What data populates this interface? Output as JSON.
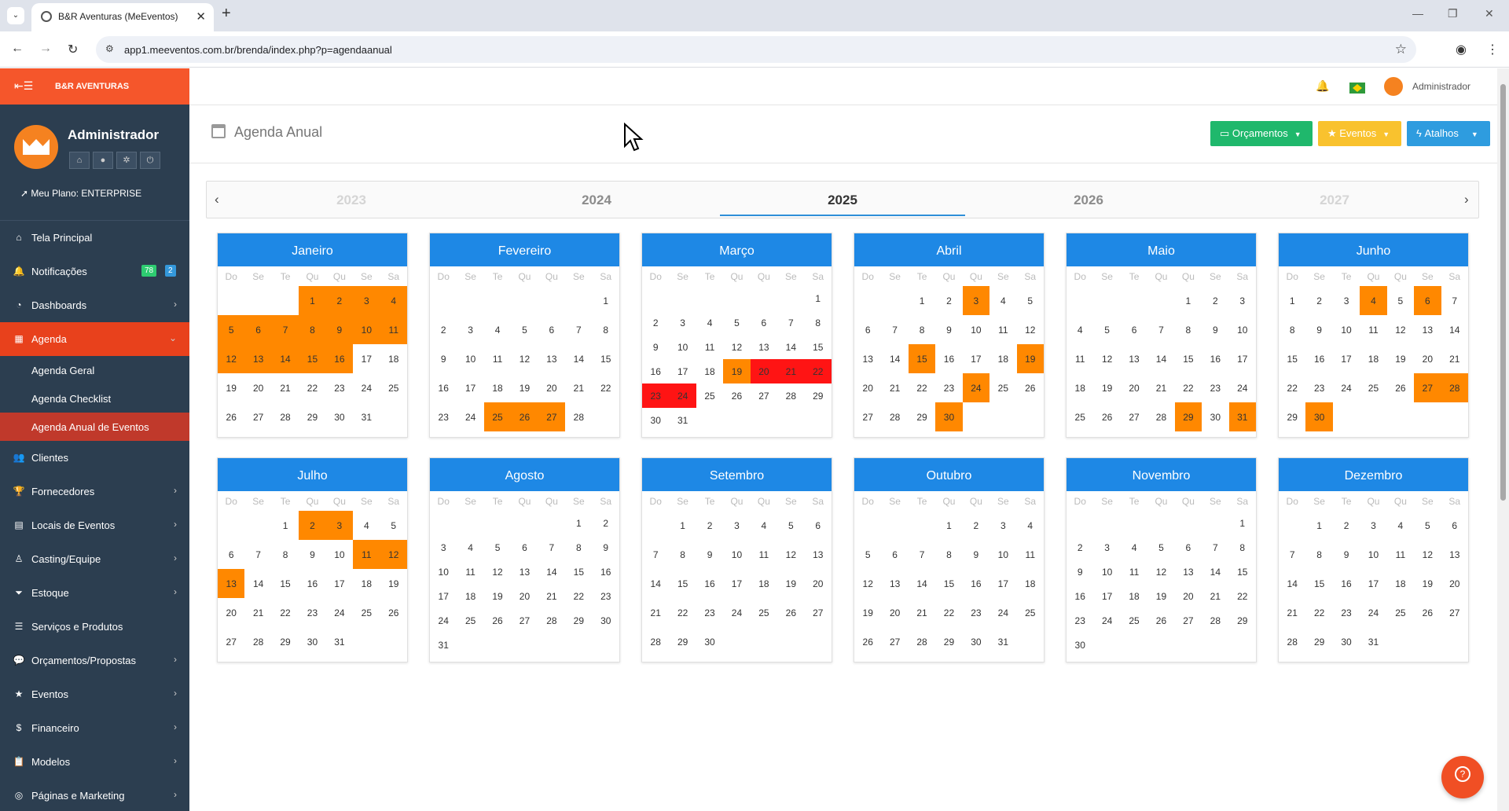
{
  "browser": {
    "tab_title": "B&R Aventuras (MeEventos)",
    "url": "app1.meeventos.com.br/brenda/index.php?p=agendaanual"
  },
  "sidebar": {
    "brand": "B&R AVENTURAS",
    "user_name": "Administrador",
    "plan": "Meu Plano: ENTERPRISE",
    "items": [
      {
        "label": "Tela Principal",
        "icon": "home-icon",
        "chev": ""
      },
      {
        "label": "Notificações",
        "icon": "bell-icon",
        "chev": "",
        "badge1": "78",
        "badge2": "2"
      },
      {
        "label": "Dashboards",
        "icon": "dashboard-icon",
        "chev": "›"
      },
      {
        "label": "Agenda",
        "icon": "calendar-icon",
        "chev": "⌄",
        "active": true
      },
      {
        "label": "Clientes",
        "icon": "users-icon",
        "chev": ""
      },
      {
        "label": "Fornecedores",
        "icon": "trophy-icon",
        "chev": "›"
      },
      {
        "label": "Locais de Eventos",
        "icon": "building-icon",
        "chev": "›"
      },
      {
        "label": "Casting/Equipe",
        "icon": "person-icon",
        "chev": "›"
      },
      {
        "label": "Estoque",
        "icon": "filter-icon",
        "chev": "›"
      },
      {
        "label": "Serviços e Produtos",
        "icon": "list-icon",
        "chev": ""
      },
      {
        "label": "Orçamentos/Propostas",
        "icon": "chat-icon",
        "chev": "›"
      },
      {
        "label": "Eventos",
        "icon": "star-icon",
        "chev": "›"
      },
      {
        "label": "Financeiro",
        "icon": "dollar-icon",
        "chev": "›"
      },
      {
        "label": "Modelos",
        "icon": "clipboard-icon",
        "chev": "›"
      },
      {
        "label": "Páginas e Marketing",
        "icon": "globe-icon",
        "chev": "›"
      }
    ],
    "agenda_sub": [
      "Agenda Geral",
      "Agenda Checklist",
      "Agenda Anual de Eventos"
    ]
  },
  "topnav": {
    "user": "Administrador"
  },
  "page": {
    "title": "Agenda Anual",
    "btn_orcamentos": "Orçamentos",
    "btn_eventos": "Eventos",
    "btn_atalhos": "Atalhos"
  },
  "years": [
    "2023",
    "2024",
    "2025",
    "2026",
    "2027"
  ],
  "active_year": "2025",
  "weekdays": [
    "Do",
    "Se",
    "Te",
    "Qu",
    "Qu",
    "Se",
    "Sa"
  ],
  "colors": {
    "orange": "#ff8800",
    "red": "#ff1414",
    "blue": "#1e88e5"
  },
  "months": [
    {
      "name": "Janeiro",
      "start": 3,
      "days": 31,
      "orange": [
        1,
        2,
        3,
        4,
        5,
        6,
        7,
        8,
        9,
        10,
        11,
        12,
        13,
        14,
        15,
        16
      ],
      "red": []
    },
    {
      "name": "Fevereiro",
      "start": 6,
      "days": 28,
      "orange": [
        25,
        26,
        27
      ],
      "red": []
    },
    {
      "name": "Março",
      "start": 6,
      "days": 31,
      "orange": [
        19
      ],
      "red": [
        20,
        21,
        22,
        23,
        24
      ]
    },
    {
      "name": "Abril",
      "start": 2,
      "days": 30,
      "orange": [
        3,
        15,
        19,
        24,
        30
      ],
      "red": []
    },
    {
      "name": "Maio",
      "start": 4,
      "days": 31,
      "orange": [
        29,
        31
      ],
      "red": []
    },
    {
      "name": "Junho",
      "start": 0,
      "days": 30,
      "orange": [
        4,
        6,
        27,
        28,
        30
      ],
      "red": []
    },
    {
      "name": "Julho",
      "start": 2,
      "days": 31,
      "orange": [
        2,
        3,
        11,
        12,
        13
      ],
      "red": []
    },
    {
      "name": "Agosto",
      "start": 5,
      "days": 31,
      "orange": [],
      "red": []
    },
    {
      "name": "Setembro",
      "start": 1,
      "days": 30,
      "orange": [],
      "red": []
    },
    {
      "name": "Outubro",
      "start": 3,
      "days": 31,
      "orange": [],
      "red": []
    },
    {
      "name": "Novembro",
      "start": 6,
      "days": 30,
      "orange": [],
      "red": []
    },
    {
      "name": "Dezembro",
      "start": 1,
      "days": 31,
      "orange": [],
      "red": []
    }
  ]
}
